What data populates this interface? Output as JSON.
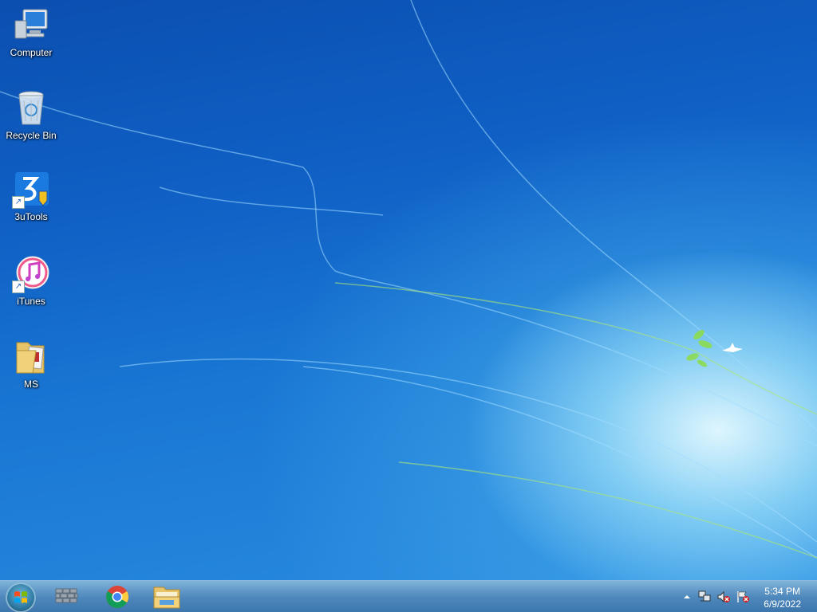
{
  "desktop": {
    "icons": [
      {
        "label": "Computer",
        "icon": "computer-icon"
      },
      {
        "label": "Recycle Bin",
        "icon": "recycle-bin-icon"
      },
      {
        "label": "3uTools",
        "icon": "3utools-icon"
      },
      {
        "label": "iTunes",
        "icon": "itunes-icon"
      },
      {
        "label": "MS",
        "icon": "folder-icon"
      }
    ]
  },
  "taskbar": {
    "start_icon": "windows-start-icon",
    "pinned": [
      {
        "icon": "network-wall-icon"
      },
      {
        "icon": "chrome-icon"
      },
      {
        "icon": "file-explorer-icon"
      }
    ],
    "tray": {
      "icons": [
        "show-hidden-icons-chevron",
        "network-icon",
        "volume-muted-icon",
        "action-center-flag-icon"
      ]
    },
    "clock": {
      "time": "5:34 PM",
      "date": "6/9/2022"
    }
  },
  "colors": {
    "desktop_blue": "#0f5fc4",
    "glow": "#e6faff",
    "taskbar": "#4682b9"
  }
}
